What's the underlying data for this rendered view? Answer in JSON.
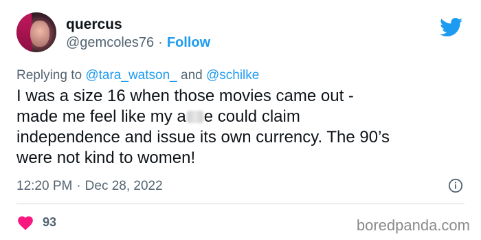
{
  "author": {
    "name": "quercus",
    "handle": "@gemcoles76",
    "separator": "·",
    "follow_label": "Follow"
  },
  "reply": {
    "prefix": "Replying to",
    "mention_1": "@tara_watson_",
    "conjunction": "and",
    "mention_2": "@schilke"
  },
  "tweet": {
    "line_1": "I was a size 16 when those movies came out -",
    "line_2_before": "made me feel like my a",
    "line_2_after": "e could claim",
    "line_3": "independence and issue its own currency. The 90’s",
    "line_4": "were not kind to women!"
  },
  "meta": {
    "time": "12:20 PM",
    "separator": "·",
    "date": "Dec 28, 2022"
  },
  "engagement": {
    "likes": "93"
  },
  "watermark": "boredpanda.com",
  "colors": {
    "accent": "#1d9bf0",
    "heart": "#f91880",
    "muted": "#536471"
  },
  "icons": [
    "twitter-bird-icon",
    "info-icon",
    "heart-icon"
  ]
}
